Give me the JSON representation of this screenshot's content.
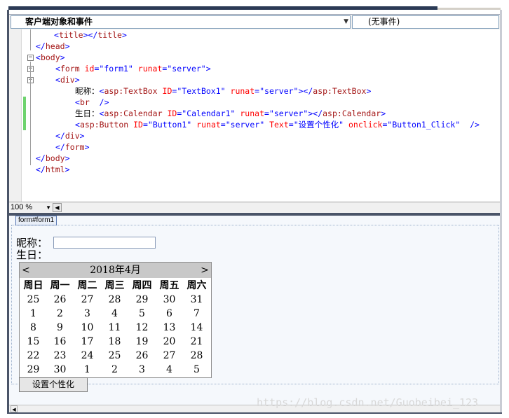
{
  "dropdowns": {
    "object_label": "客户端对象和事件",
    "event_label": "(无事件)"
  },
  "code_lines": [
    "<title></title>",
    "</head>",
    "<body>",
    "<form id=\"form1\" runat=\"server\">",
    "<div>",
    "昵称：<asp:TextBox ID=\"TextBox1\" runat=\"server\"></asp:TextBox>",
    "<br />",
    "生日：<asp:Calendar ID=\"Calendar1\" runat=\"server\"></asp:Calendar>",
    "<asp:Button ID=\"Button1\" runat=\"server\" Text=\"设置个性化\" onclick=\"Button1_Click\" />",
    "</div>",
    "</form>",
    "</body>",
    "</html>"
  ],
  "status": {
    "zoom": "100 %"
  },
  "design": {
    "form_tag": "form#form1",
    "nickname_label": "昵称：",
    "birthday_label": "生日：",
    "button_text": "设置个性化",
    "calendar": {
      "prev": "<",
      "next": ">",
      "title": "2018年4月",
      "weekdays": [
        "周日",
        "周一",
        "周二",
        "周三",
        "周四",
        "周五",
        "周六"
      ],
      "weeks": [
        [
          "25",
          "26",
          "27",
          "28",
          "29",
          "30",
          "31"
        ],
        [
          "1",
          "2",
          "3",
          "4",
          "5",
          "6",
          "7"
        ],
        [
          "8",
          "9",
          "10",
          "11",
          "12",
          "13",
          "14"
        ],
        [
          "15",
          "16",
          "17",
          "18",
          "19",
          "20",
          "21"
        ],
        [
          "22",
          "23",
          "24",
          "25",
          "26",
          "27",
          "28"
        ],
        [
          "29",
          "30",
          "1",
          "2",
          "3",
          "4",
          "5"
        ]
      ]
    }
  },
  "watermark": "https://blog.csdn.net/Guobeibei_123"
}
